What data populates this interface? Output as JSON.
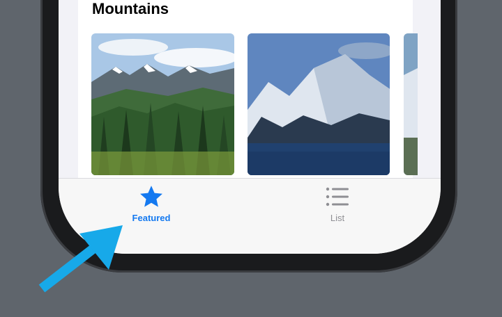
{
  "section": {
    "title": "Mountains"
  },
  "tabs": [
    {
      "label": "Featured",
      "icon": "star-icon",
      "active": true
    },
    {
      "label": "List",
      "icon": "list-icon",
      "active": false
    }
  ],
  "colors": {
    "accent": "#1479f0",
    "inactive": "#8e8e93",
    "annotation_arrow": "#17a9e9"
  }
}
